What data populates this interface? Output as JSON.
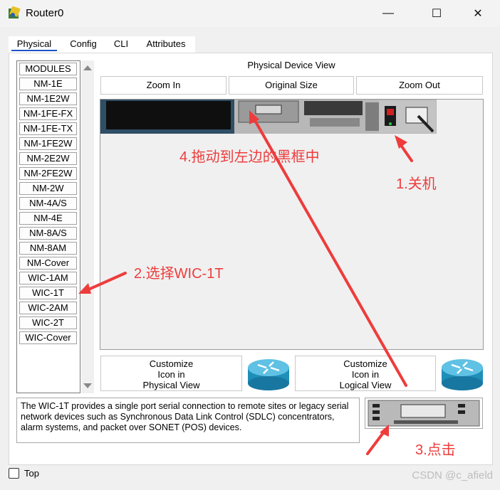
{
  "window": {
    "title": "Router0",
    "minimize_icon": "—",
    "maximize_icon": "☐",
    "close_icon": "✕"
  },
  "tabs": [
    "Physical",
    "Config",
    "CLI",
    "Attributes"
  ],
  "modules": [
    "MODULES",
    "NM-1E",
    "NM-1E2W",
    "NM-1FE-FX",
    "NM-1FE-TX",
    "NM-1FE2W",
    "NM-2E2W",
    "NM-2FE2W",
    "NM-2W",
    "NM-4A/S",
    "NM-4E",
    "NM-8A/S",
    "NM-8AM",
    "NM-Cover",
    "WIC-1AM",
    "WIC-1T",
    "WIC-2AM",
    "WIC-2T",
    "WIC-Cover"
  ],
  "device_view": {
    "label": "Physical Device View",
    "zoom_in": "Zoom In",
    "original_size": "Original Size",
    "zoom_out": "Zoom Out"
  },
  "customize": {
    "physical": [
      "Customize",
      "Icon in",
      "Physical View"
    ],
    "logical": [
      "Customize",
      "Icon in",
      "Logical View"
    ]
  },
  "description": "The WIC-1T provides a single port serial connection to remote sites or legacy serial network devices such as Synchronous Data Link Control (SDLC) concentrators, alarm systems, and packet over SONET (POS) devices.",
  "top_checkbox": {
    "label": "Top",
    "checked": false
  },
  "annotations": {
    "power_off": "1.关机",
    "select_module": "2.选择WIC-1T",
    "click": "3.点击",
    "drag": "4.拖动到左边的黑框中"
  },
  "watermark": "CSDN @c_afield",
  "colors": {
    "annotation": "#ee3c3c",
    "tab_underline": "#1a55c4",
    "router_icon": "#1e8fb8"
  }
}
